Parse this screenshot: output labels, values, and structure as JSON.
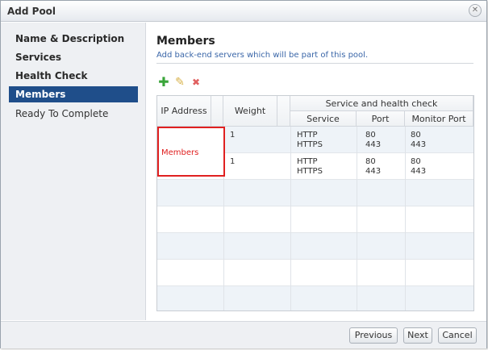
{
  "window": {
    "title": "Add Pool",
    "close_glyph": "✕"
  },
  "sidebar": {
    "items": [
      {
        "label": "Name & Description"
      },
      {
        "label": "Services"
      },
      {
        "label": "Health Check"
      },
      {
        "label": "Members"
      },
      {
        "label": "Ready To Complete"
      }
    ],
    "active_index": 3
  },
  "main": {
    "heading": "Members",
    "subtitle": "Add back-end servers which will be part of this pool.",
    "toolbar": {
      "add_icon": "plus-icon",
      "edit_icon": "pencil-icon",
      "delete_icon": "x-icon"
    },
    "table": {
      "headers": {
        "ip": "IP Address",
        "weight": "Weight",
        "group": "Service and health check",
        "service": "Service",
        "port": "Port",
        "monitor_port": "Monitor Port"
      },
      "rows": [
        {
          "weight": "1",
          "service_1": "HTTP",
          "service_2": "HTTPS",
          "port_1": "80",
          "port_2": "443",
          "monitor_1": "80",
          "monitor_2": "443"
        },
        {
          "weight": "1",
          "service_1": "HTTP",
          "service_2": "HTTPS",
          "port_1": "80",
          "port_2": "443",
          "monitor_1": "80",
          "monitor_2": "443"
        }
      ],
      "ip_annotation": "Members"
    }
  },
  "footer": {
    "previous": "Previous",
    "next": "Next",
    "cancel": "Cancel"
  },
  "colors": {
    "active_step": "#1f4e8a",
    "subtitle": "#3a66a8",
    "annotation": "#e02020"
  }
}
